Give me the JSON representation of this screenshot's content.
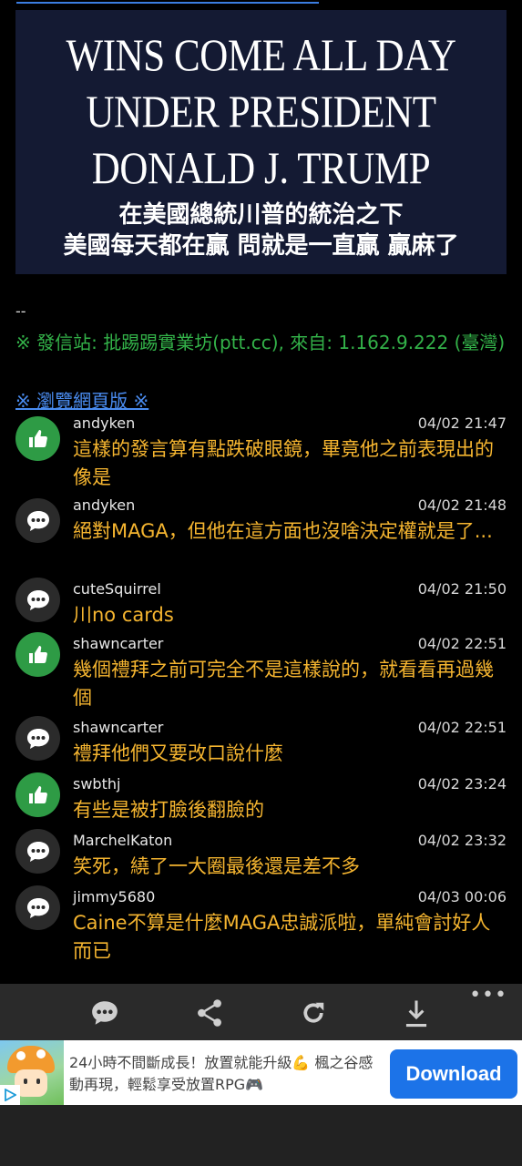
{
  "banner": {
    "lines_en": [
      "WINS COME ALL DAY",
      "UNDER PRESIDENT",
      "DONALD J. TRUMP"
    ],
    "lines_cn": [
      "在美國總統川普的統治之下",
      "美國每天都在贏 問就是一直贏 贏麻了"
    ]
  },
  "signature": {
    "dash": "--",
    "source_line": "※ 發信站: 批踢踢實業坊(ptt.cc), 來自: 1.162.9.222 (臺灣)",
    "web_link": "※ 瀏覽網頁版 ※"
  },
  "comments": [
    {
      "type": "push",
      "user": "andyken",
      "time": "04/02 21:47",
      "text": "這樣的發言算有點跌破眼鏡，畢竟他之前表現出的像是"
    },
    {
      "type": "neutral",
      "user": "andyken",
      "time": "04/02 21:48",
      "text": "絕對MAGA，但他在這方面也沒啥決定權就是了..."
    },
    {
      "type": "neutral",
      "user": "cuteSquirrel",
      "time": "04/02 21:50",
      "text": "川no cards"
    },
    {
      "type": "push",
      "user": "shawncarter",
      "time": "04/02 22:51",
      "text": "幾個禮拜之前可完全不是這樣說的，就看看再過幾個"
    },
    {
      "type": "neutral",
      "user": "shawncarter",
      "time": "04/02 22:51",
      "text": "禮拜他們又要改口說什麼"
    },
    {
      "type": "push",
      "user": "swbthj",
      "time": "04/02 23:24",
      "text": "有些是被打臉後翻臉的"
    },
    {
      "type": "neutral",
      "user": "MarchelKaton",
      "time": "04/02 23:32",
      "text": "笑死，繞了一大圈最後還是差不多"
    },
    {
      "type": "neutral",
      "user": "jimmy5680",
      "time": "04/03 00:06",
      "text": "Caine不算是什麼MAGA忠誠派啦，單純會討好人而已"
    }
  ],
  "toolbar": {
    "icons": [
      "comment-icon",
      "share-icon",
      "refresh-icon",
      "download-icon",
      "more-icon"
    ],
    "more_label": "•••"
  },
  "ad": {
    "text": "24小時不間斷成長！放置就能升級💪 楓之谷感動再現，輕鬆享受放置RPG🎮",
    "button_label": "Download",
    "accent": "#1c73e8"
  },
  "colors": {
    "push": "#2e9b45",
    "comment_text": "#f5b530",
    "signature": "#33b249",
    "link": "#4a8cf0"
  }
}
